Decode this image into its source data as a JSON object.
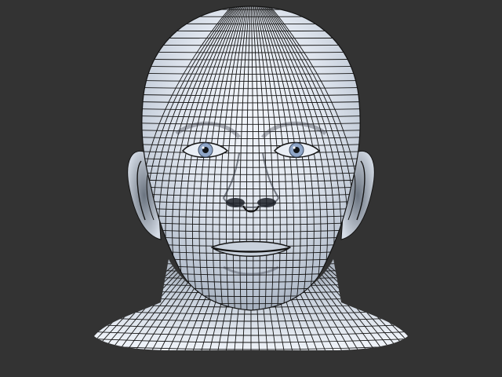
{
  "scene": {
    "background_color": "#333333",
    "subject": "wireframe-head-mesh",
    "mesh_fill_light": "#e8edf5",
    "mesh_fill_mid": "#aab6c6",
    "mesh_fill_dark": "#2a2f38",
    "wire_color": "#141414",
    "iris_color": "#8fa6c8",
    "pupil_color": "#101418"
  }
}
